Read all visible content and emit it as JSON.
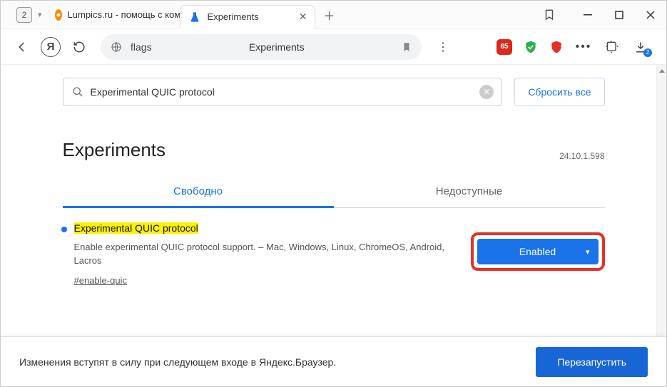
{
  "titlebar": {
    "tab_count": "2",
    "bg_tab_label": "Lumpics.ru - помощь с ком",
    "active_tab_label": "Experiments"
  },
  "toolbar": {
    "address_host": "flags",
    "address_title": "Experiments",
    "ext_badge_1": "65",
    "download_badge": "2"
  },
  "flags_page": {
    "search_value": "Experimental QUIC protocol",
    "reset_label": "Сбросить все",
    "heading": "Experiments",
    "version": "24.10.1.598",
    "tab_available": "Свободно",
    "tab_unavailable": "Недоступные",
    "flag": {
      "title": "Experimental QUIC protocol",
      "description": "Enable experimental QUIC protocol support. – Mac, Windows, Linux, ChromeOS, Android, Lacros",
      "hash": "#enable-quic",
      "select_value": "Enabled"
    }
  },
  "footer": {
    "text": "Изменения вступят в силу при следующем входе в Яндекс.Браузер.",
    "restart_label": "Перезапустить"
  }
}
